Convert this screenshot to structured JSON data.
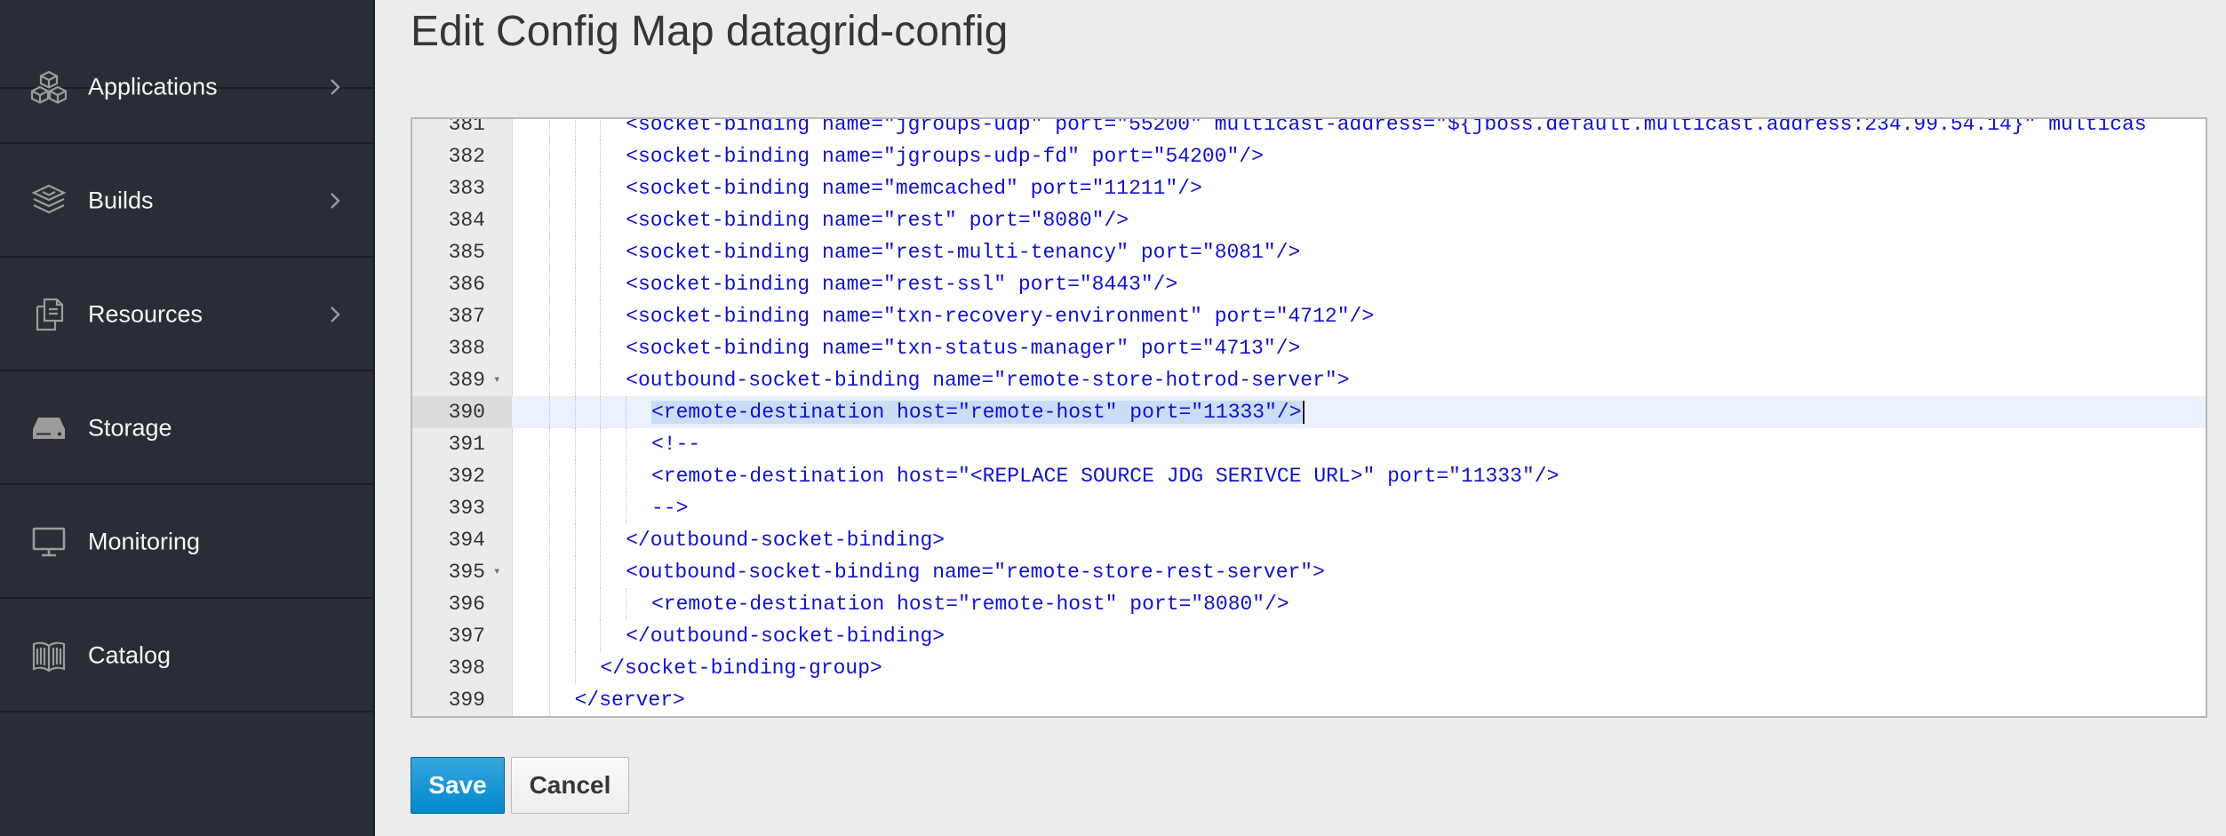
{
  "sidebar": {
    "items": [
      {
        "label": "Applications",
        "icon": "cubes-icon",
        "has_children": true
      },
      {
        "label": "Builds",
        "icon": "layers-icon",
        "has_children": true
      },
      {
        "label": "Resources",
        "icon": "files-icon",
        "has_children": true
      },
      {
        "label": "Storage",
        "icon": "storage-drive-icon",
        "has_children": false
      },
      {
        "label": "Monitoring",
        "icon": "desktop-icon",
        "has_children": false
      },
      {
        "label": "Catalog",
        "icon": "book-icon",
        "has_children": false
      }
    ]
  },
  "page": {
    "title": "Edit Config Map datagrid-config"
  },
  "editor": {
    "active_line": 390,
    "lines": [
      {
        "num": "381",
        "text": "<socket-binding name=\"jgroups-udp\" port=\"55200\" multicast-address=\"${jboss.default.multicast.address:234.99.54.14}\" multicas"
      },
      {
        "num": "382",
        "text": "<socket-binding name=\"jgroups-udp-fd\" port=\"54200\"/>"
      },
      {
        "num": "383",
        "text": "<socket-binding name=\"memcached\" port=\"11211\"/>"
      },
      {
        "num": "384",
        "text": "<socket-binding name=\"rest\" port=\"8080\"/>"
      },
      {
        "num": "385",
        "text": "<socket-binding name=\"rest-multi-tenancy\" port=\"8081\"/>"
      },
      {
        "num": "386",
        "text": "<socket-binding name=\"rest-ssl\" port=\"8443\"/>"
      },
      {
        "num": "387",
        "text": "<socket-binding name=\"txn-recovery-environment\" port=\"4712\"/>"
      },
      {
        "num": "388",
        "text": "<socket-binding name=\"txn-status-manager\" port=\"4713\"/>"
      },
      {
        "num": "389",
        "text": "<outbound-socket-binding name=\"remote-store-hotrod-server\">"
      },
      {
        "num": "390",
        "text": "<remote-destination host=\"remote-host\" port=\"11333\"/>"
      },
      {
        "num": "391",
        "text": "<!--"
      },
      {
        "num": "392",
        "text": "<remote-destination host=\"<REPLACE SOURCE JDG SERIVCE URL>\" port=\"11333\"/>"
      },
      {
        "num": "393",
        "text": "-->"
      },
      {
        "num": "394",
        "text": "</outbound-socket-binding>"
      },
      {
        "num": "395",
        "text": "<outbound-socket-binding name=\"remote-store-rest-server\">"
      },
      {
        "num": "396",
        "text": "<remote-destination host=\"remote-host\" port=\"8080\"/>"
      },
      {
        "num": "397",
        "text": "</outbound-socket-binding>"
      },
      {
        "num": "398",
        "text": "</socket-binding-group>"
      },
      {
        "num": "399",
        "text": "</server>"
      }
    ]
  },
  "actions": {
    "save_label": "Save",
    "cancel_label": "Cancel"
  },
  "colors": {
    "sidebar_bg": "#292e34",
    "code_text": "#1111cc",
    "primary_button": "#0088ce",
    "active_line_bg": "#e8f1fc"
  }
}
